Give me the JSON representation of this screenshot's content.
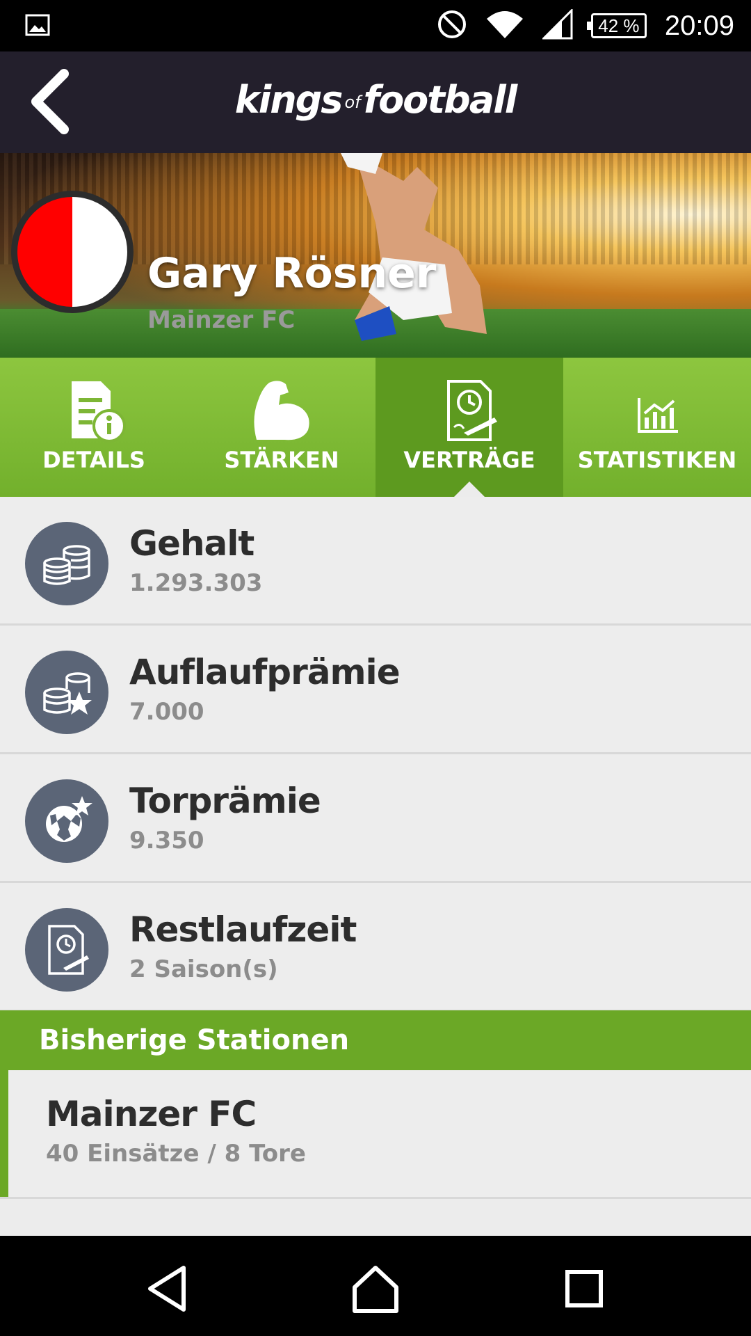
{
  "status_bar": {
    "battery": "42 %",
    "time": "20:09",
    "icons": [
      "image-icon",
      "no-disturb-icon",
      "wifi-icon",
      "signal-icon",
      "battery-icon"
    ]
  },
  "app_bar": {
    "logo_part1": "kings",
    "logo_part2": "of",
    "logo_part3": "football"
  },
  "hero": {
    "player_name": "Gary Rösner",
    "club": "Mainzer FC",
    "badge_colors": [
      "#ff0000",
      "#ffffff"
    ]
  },
  "tabs": [
    {
      "label": "DETAILS",
      "icon": "document-info-icon",
      "active": false
    },
    {
      "label": "STÄRKEN",
      "icon": "muscle-arm-icon",
      "active": false
    },
    {
      "label": "VERTRÄGE",
      "icon": "contract-icon",
      "active": true
    },
    {
      "label": "STATISTIKEN",
      "icon": "chart-icon",
      "active": false
    }
  ],
  "contract": [
    {
      "title": "Gehalt",
      "value": "1.293.303",
      "icon": "coins-icon"
    },
    {
      "title": "Auflaufprämie",
      "value": "7.000",
      "icon": "coins-star-icon"
    },
    {
      "title": "Torprämie",
      "value": "9.350",
      "icon": "ball-star-icon"
    },
    {
      "title": "Restlaufzeit",
      "value": "2 Saison(s)",
      "icon": "contract-clock-icon"
    }
  ],
  "history": {
    "heading": "Bisherige Stationen",
    "stations": [
      {
        "club": "Mainzer FC",
        "stats": "40 Einsätze / 8 Tore"
      }
    ]
  },
  "colors": {
    "accent_green": "#72b02c",
    "active_tab": "#5d9a1f",
    "header_bg": "#231f2c",
    "icon_circle": "#5b6577"
  }
}
